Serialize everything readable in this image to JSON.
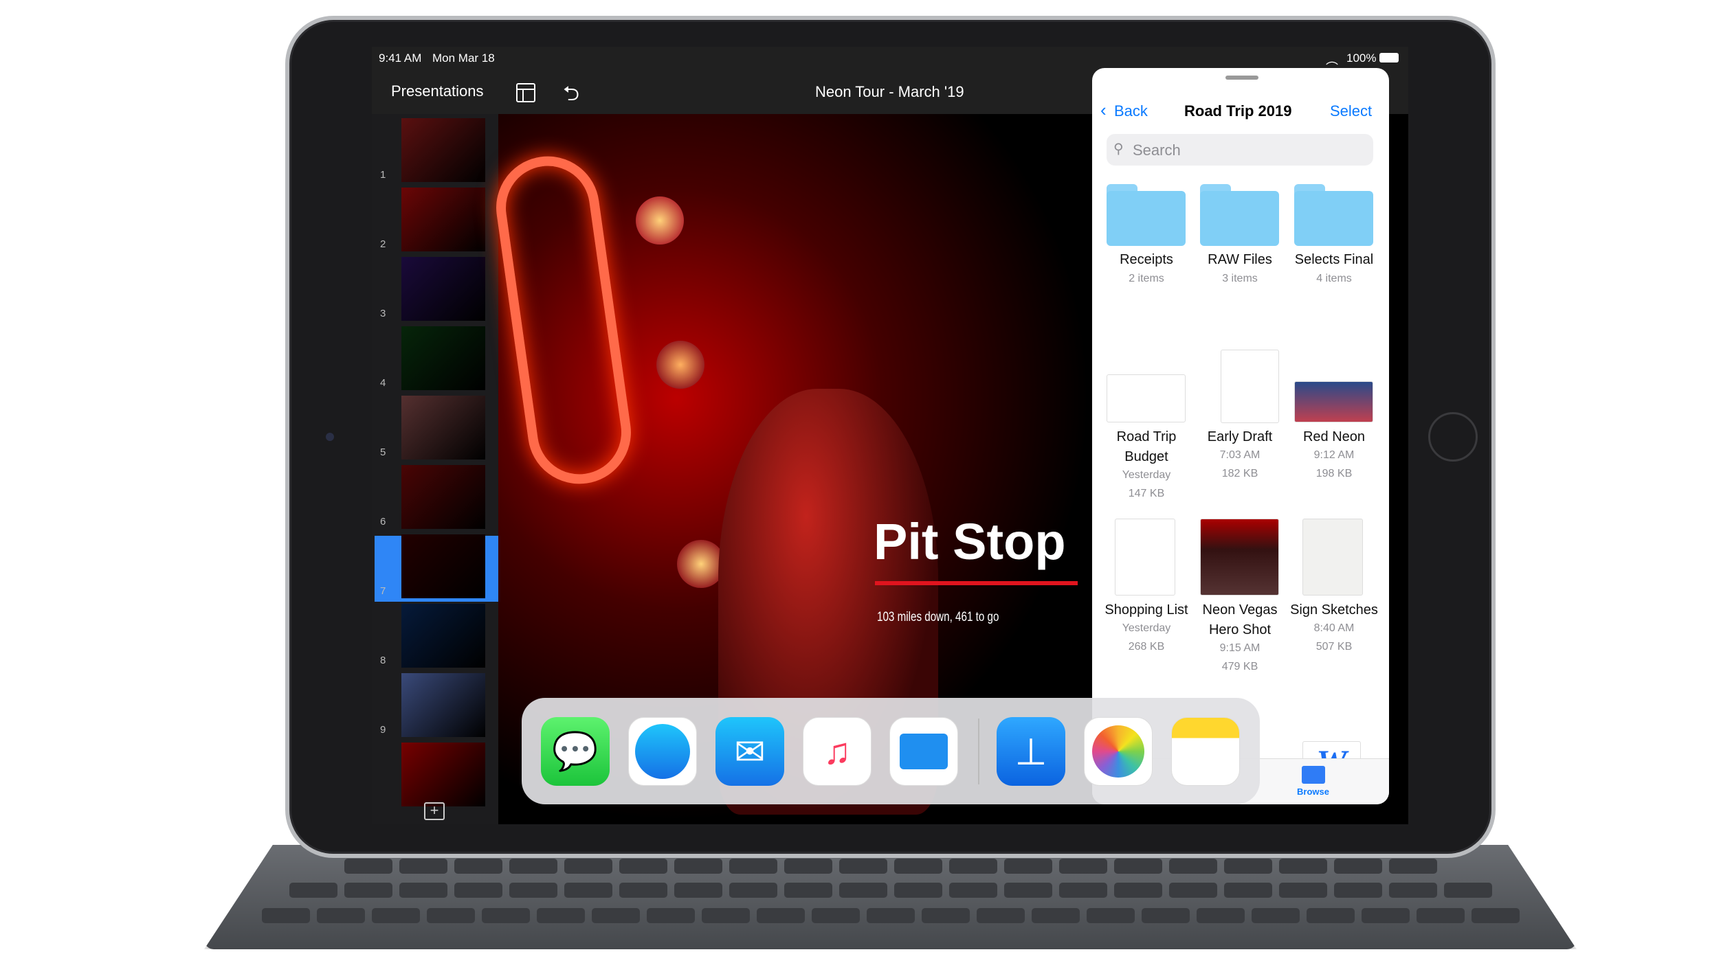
{
  "status": {
    "time": "9:41 AM",
    "date": "Mon Mar 18",
    "battery": "100%"
  },
  "toolbar": {
    "back_label": "Presentations",
    "title": "Neon Tour - March '19"
  },
  "sidebar": {
    "slides": [
      "1",
      "2",
      "3",
      "4",
      "5",
      "6",
      "7",
      "8",
      "9",
      ""
    ],
    "selected": 7
  },
  "slide": {
    "title": "Pit Stop",
    "subtitle": "103 miles down, 461 to go",
    "accent": "#e0141e"
  },
  "files": {
    "back": "Back",
    "title": "Road Trip 2019",
    "select": "Select",
    "search_placeholder": "Search",
    "accent": "#0a7aff",
    "folders": [
      {
        "name": "Receipts",
        "sub": "2 items"
      },
      {
        "name": "RAW Files",
        "sub": "3 items"
      },
      {
        "name": "Selects Final",
        "sub": "4 items"
      }
    ],
    "row2": [
      {
        "name1": "Road Trip",
        "name2": "Budget",
        "date": "Yesterday",
        "size": "147 KB"
      },
      {
        "name1": "Early Draft",
        "date": "7:03 AM",
        "size": "182 KB"
      },
      {
        "name1": "Red Neon",
        "date": "9:12 AM",
        "size": "198 KB"
      }
    ],
    "row3": [
      {
        "name1": "Shopping List",
        "date": "Yesterday",
        "size": "268 KB"
      },
      {
        "name1": "Neon Vegas",
        "name2": "Hero Shot",
        "date": "9:15 AM",
        "size": "479 KB"
      },
      {
        "name1": "Sign Sketches",
        "date": "8:40 AM",
        "size": "507 KB"
      }
    ],
    "word_glyph": "W",
    "tab_browse": "Browse"
  },
  "dock": {
    "apps": [
      "messages",
      "safari",
      "mail",
      "music",
      "files",
      "keynote",
      "photos",
      "notes"
    ]
  }
}
